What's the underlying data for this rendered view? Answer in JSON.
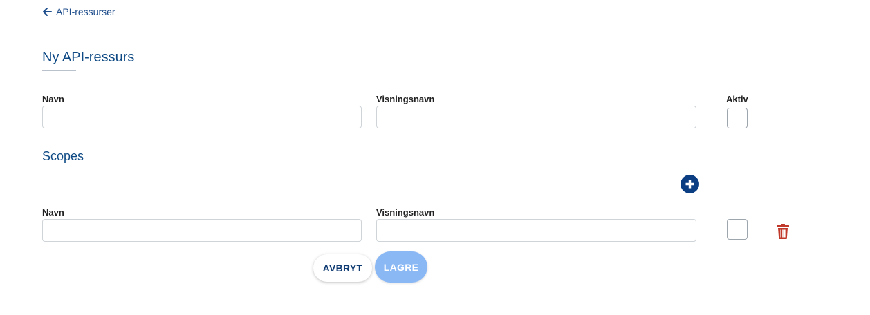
{
  "nav": {
    "back_label": "API-ressurser"
  },
  "page": {
    "title": "Ny API-ressurs"
  },
  "resource": {
    "name_label": "Navn",
    "name_value": "",
    "display_name_label": "Visningsnavn",
    "display_name_value": "",
    "active_label": "Aktiv",
    "active_checked": false
  },
  "scopes": {
    "title": "Scopes",
    "add_icon": "plus-circle-icon",
    "rows": [
      {
        "name_label": "Navn",
        "name_value": "",
        "display_name_label": "Visningsnavn",
        "display_name_value": "",
        "checked": false,
        "delete_icon": "trash-icon"
      }
    ]
  },
  "actions": {
    "cancel_label": "AVBRYT",
    "save_label": "LAGRE"
  },
  "colors": {
    "primary": "#0f4a85",
    "add_button": "#0b3d82",
    "delete": "#c0392b",
    "save_disabled": "#8ab8f5"
  }
}
